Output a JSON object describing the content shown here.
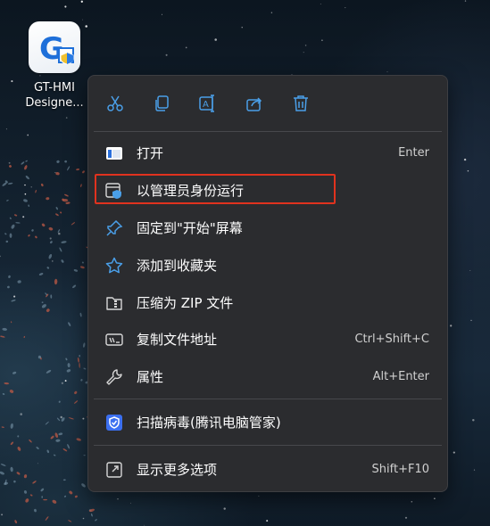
{
  "desktop": {
    "icon": {
      "name": "app-icon-gt-hmi-designer",
      "label_line1": "GT-HMI",
      "label_line2": "Designe..."
    }
  },
  "context_menu": {
    "toolbar": [
      {
        "name": "cut-button",
        "icon": "scissors-icon"
      },
      {
        "name": "copy-button",
        "icon": "copy-icon"
      },
      {
        "name": "rename-button",
        "icon": "rename-icon"
      },
      {
        "name": "share-button",
        "icon": "share-icon"
      },
      {
        "name": "delete-button",
        "icon": "trash-icon"
      }
    ],
    "items": [
      {
        "label": "打开",
        "shortcut": "Enter",
        "icon": "open-window-icon"
      },
      {
        "label": "以管理员身份运行",
        "shortcut": "",
        "icon": "shield-admin-icon",
        "highlighted": true
      },
      {
        "label": "固定到\"开始\"屏幕",
        "shortcut": "",
        "icon": "pin-icon"
      },
      {
        "label": "添加到收藏夹",
        "shortcut": "",
        "icon": "star-icon"
      },
      {
        "label": "压缩为 ZIP 文件",
        "shortcut": "",
        "icon": "zip-folder-icon"
      },
      {
        "label": "复制文件地址",
        "shortcut": "Ctrl+Shift+C",
        "icon": "copy-path-icon"
      },
      {
        "label": "属性",
        "shortcut": "Alt+Enter",
        "icon": "wrench-icon"
      },
      {
        "label": "扫描病毒(腾讯电脑管家)",
        "shortcut": "",
        "icon": "tencent-shield-icon"
      },
      {
        "label": "显示更多选项",
        "shortcut": "Shift+F10",
        "icon": "more-options-icon"
      }
    ]
  },
  "colors": {
    "menu_bg": "#2b2c2f",
    "accent_blue": "#4a9fe8",
    "highlight_red": "#e0321e"
  }
}
